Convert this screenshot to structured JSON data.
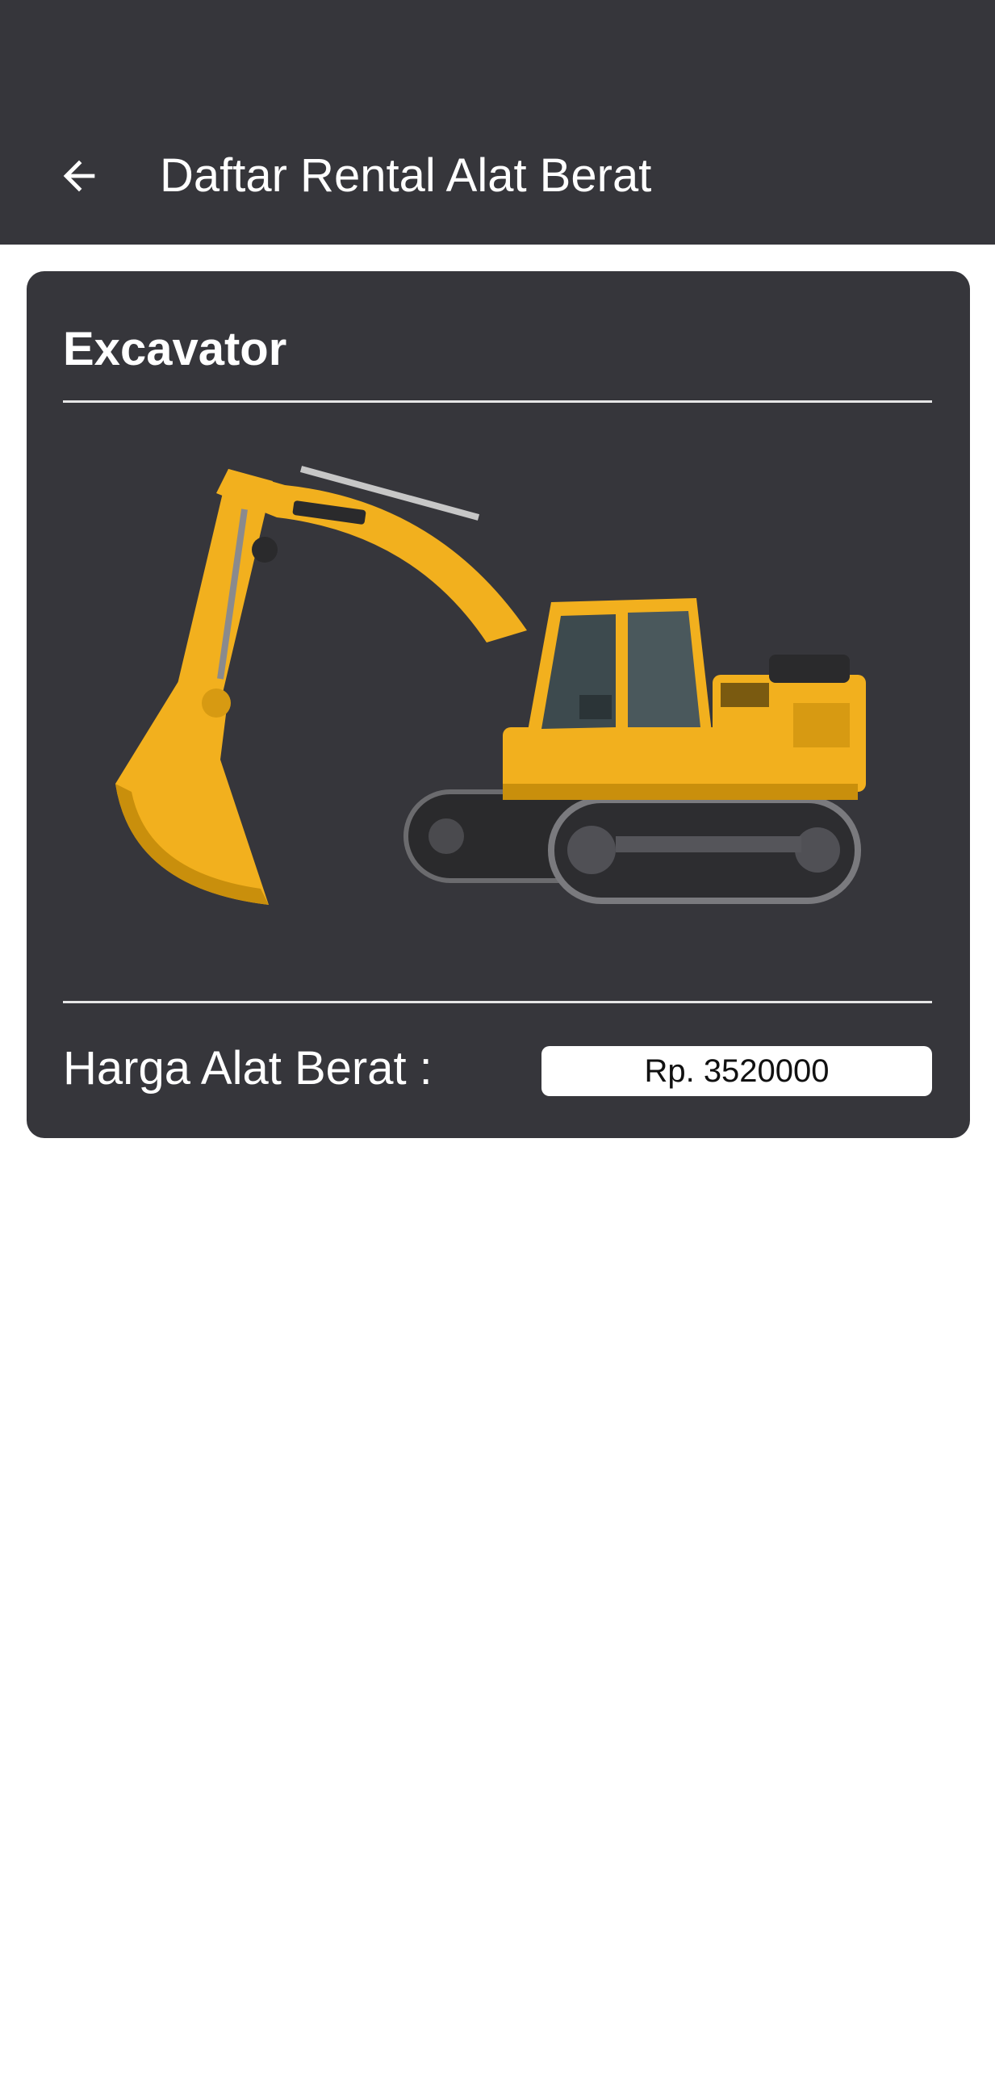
{
  "appbar": {
    "title": "Daftar Rental Alat Berat",
    "back_icon": "arrow-left-icon",
    "background": "#36363b"
  },
  "card": {
    "title": "Excavator",
    "image_alt": "Excavator",
    "price_label": "Harga Alat Berat :",
    "price_value": "Rp. 3520000",
    "background": "#36363b",
    "accent": "#f2b01e"
  }
}
